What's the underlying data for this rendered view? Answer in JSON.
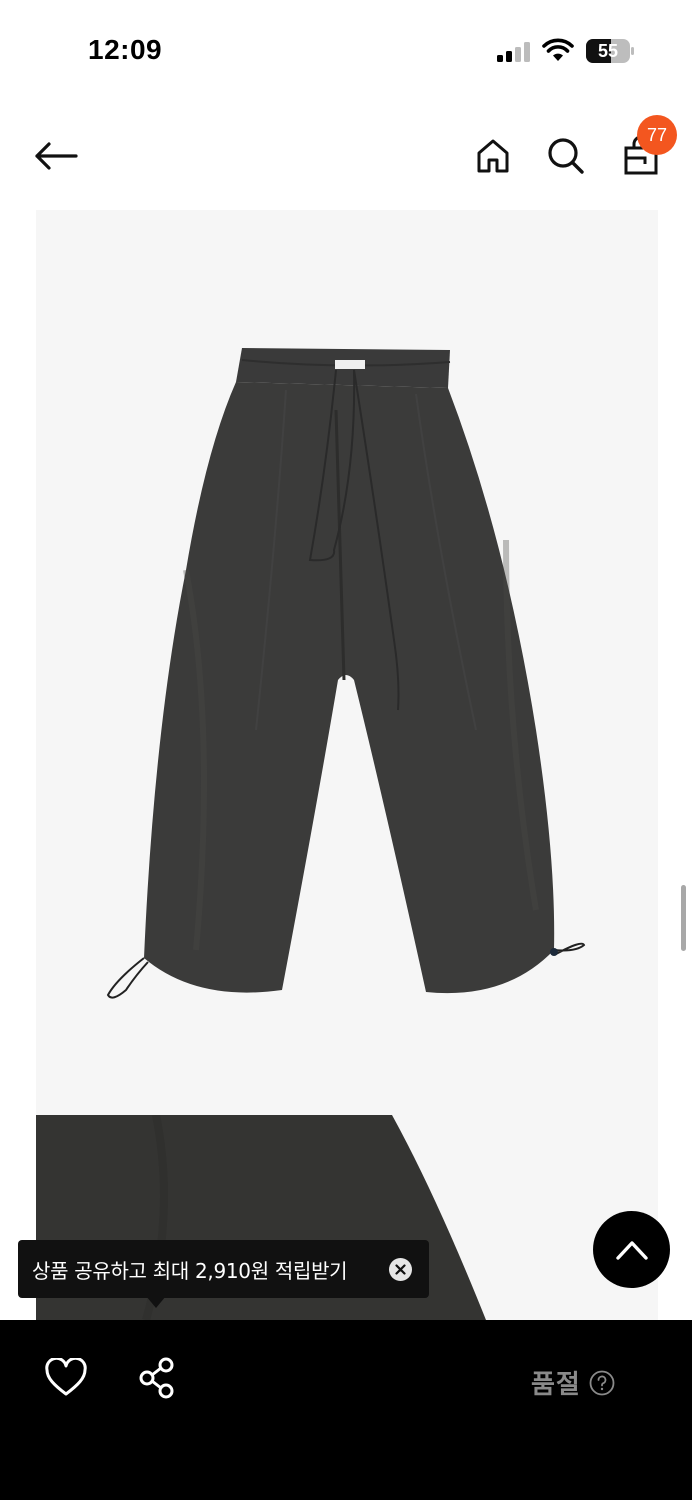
{
  "status_bar": {
    "time": "12:09",
    "battery_level": "55"
  },
  "header": {
    "cart_count": "77",
    "icons": [
      "back-arrow-icon",
      "home-icon",
      "search-icon",
      "shopping-bag-icon"
    ]
  },
  "product": {
    "image": "charcoal-wide-balloon-pants",
    "detail_image": "fabric-closeup"
  },
  "tooltip": {
    "text": "상품 공유하고 최대 2,910원 적립받기"
  },
  "bottom_bar": {
    "status_label": "품절",
    "icons": [
      "heart-icon",
      "share-icon",
      "help-circle-icon"
    ]
  },
  "colors": {
    "accent": "#f3561f",
    "bottom_bar_bg": "#000000",
    "image_bg": "#f6f6f6",
    "soldout_text": "#8a8a8a"
  }
}
